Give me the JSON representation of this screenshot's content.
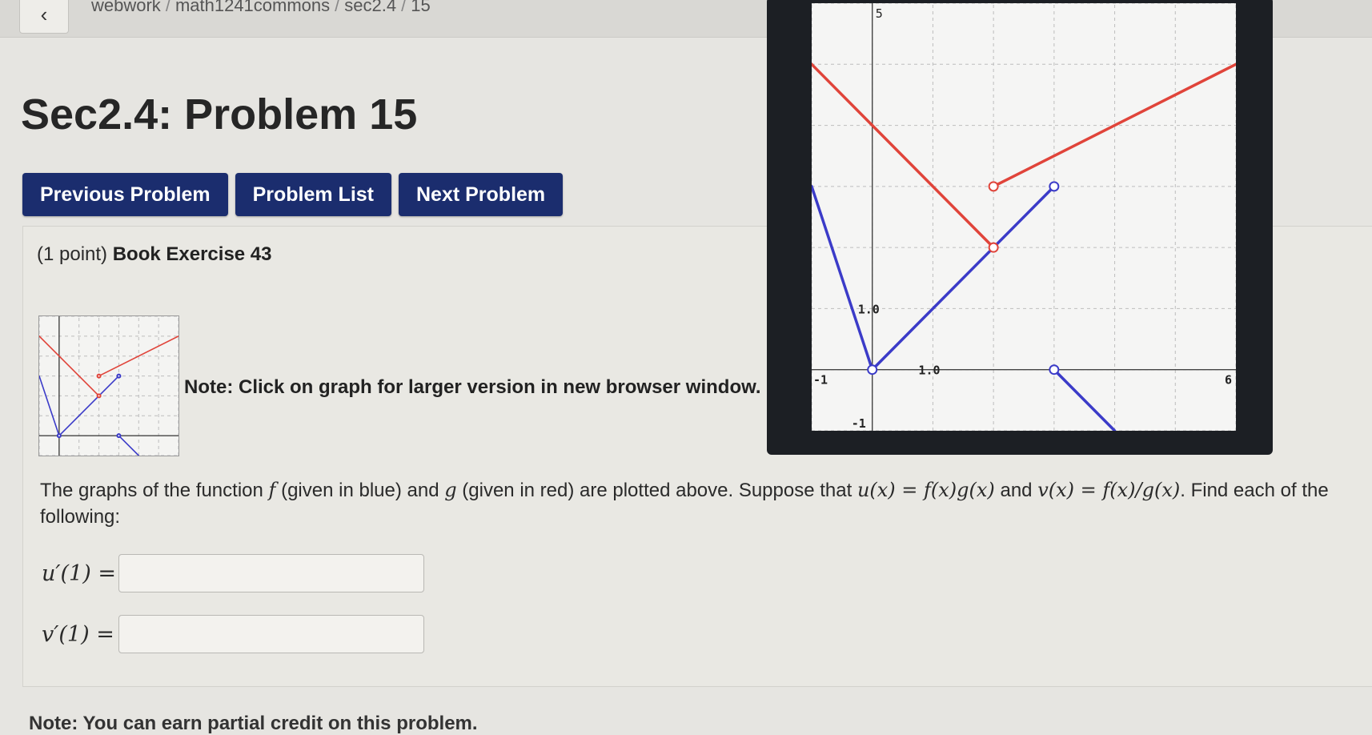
{
  "breadcrumb": [
    "webwork",
    "math1241commons",
    "sec2.4",
    "15"
  ],
  "page_title": "Sec2.4: Problem 15",
  "nav_buttons": {
    "previous": "Previous Problem",
    "list": "Problem List",
    "next": "Next Problem"
  },
  "problem": {
    "points": "(1 point)",
    "exercise": "Book Exercise 43",
    "note": "Note: Click on graph for larger version in new browser window.",
    "statement_prefix": "The graphs of the function",
    "f_symbol": "f",
    "f_desc": "(given in blue) and",
    "g_symbol": "g",
    "g_desc": "(given in red) are plotted above. Suppose that",
    "u_def": "u(x) = f(x)g(x)",
    "and_text": "and",
    "v_def": "v(x) = f(x)/g(x)",
    "statement_suffix": ". Find each of the following:",
    "answers": [
      {
        "label": "u′(1) =",
        "value": ""
      },
      {
        "label": "v′(1) =",
        "value": ""
      }
    ]
  },
  "graph": {
    "y_top_label": "5",
    "x_tick_label": "1.0",
    "y_tick_label": "1.0",
    "x_min_label": "-1",
    "x_max_label": "6",
    "y_min_label": "-1",
    "colors": {
      "f": "#3b3bc8",
      "g": "#e0443a",
      "grid": "#bdbdbd"
    }
  },
  "chart_data": {
    "type": "line",
    "xlim": [
      -1,
      6
    ],
    "ylim": [
      -1,
      6
    ],
    "grid": true,
    "series": [
      {
        "name": "f",
        "segments": [
          [
            [
              -1,
              3
            ],
            [
              0,
              0
            ]
          ],
          [
            [
              0,
              0
            ],
            [
              3,
              3
            ]
          ],
          [
            [
              3,
              0
            ],
            [
              4,
              -1
            ]
          ]
        ]
      },
      {
        "name": "g",
        "segments": [
          [
            [
              -1,
              5
            ],
            [
              2,
              2
            ]
          ],
          [
            [
              2,
              3
            ],
            [
              6,
              5
            ]
          ]
        ]
      }
    ],
    "open_points": [
      [
        0,
        0
      ],
      [
        3,
        3
      ],
      [
        2,
        2
      ],
      [
        2,
        3
      ],
      [
        3,
        0
      ]
    ]
  },
  "bottom_partial": "Note: You can earn partial credit on this problem."
}
